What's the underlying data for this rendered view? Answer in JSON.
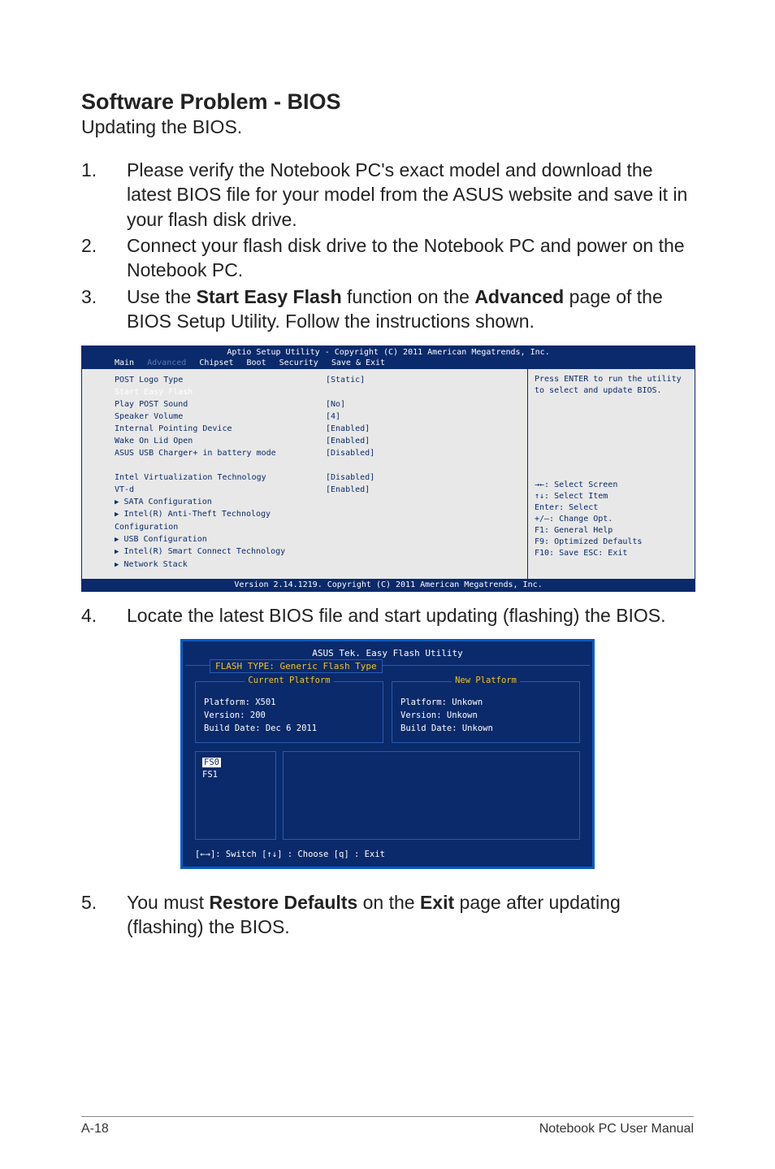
{
  "heading": "Software Problem - BIOS",
  "subtitle": "Updating the BIOS.",
  "steps": {
    "s1": {
      "num": "1.",
      "text": "Please verify the Notebook PC's exact model and download the latest BIOS file for your model from the ASUS website and save it in your flash disk drive."
    },
    "s2": {
      "num": "2.",
      "text": "Connect your flash disk drive to the Notebook PC and power on the Notebook PC."
    },
    "s3": {
      "num": "3.",
      "pre": "Use the ",
      "b1": "Start Easy Flash",
      "mid": " function on the ",
      "b2": "Advanced",
      "post": " page of the BIOS Setup Utility. Follow the instructions shown."
    },
    "s4": {
      "num": "4.",
      "text": "Locate the latest BIOS file and start updating (flashing) the BIOS."
    },
    "s5": {
      "num": "5.",
      "pre": "You must ",
      "b1": "Restore Defaults",
      "mid": " on the ",
      "b2": "Exit",
      "post": " page after updating (flashing) the BIOS."
    }
  },
  "bios": {
    "top": "Aptio Setup Utility - Copyright (C) 2011 American Megatrends, Inc.",
    "tabs": {
      "main": "Main",
      "advanced": "Advanced",
      "chipset": "Chipset",
      "boot": "Boot",
      "security": "Security",
      "save": "Save & Exit"
    },
    "rows": {
      "r1": {
        "label": "POST Logo Type",
        "val": "[Static]"
      },
      "r2": {
        "label": "Start Easy Flash",
        "val": ""
      },
      "r3": {
        "label": "Play POST Sound",
        "val": "[No]"
      },
      "r4": {
        "label": "Speaker Volume",
        "val": "[4]"
      },
      "r5": {
        "label": "Internal Pointing Device",
        "val": "[Enabled]"
      },
      "r6": {
        "label": "Wake On Lid Open",
        "val": "[Enabled]"
      },
      "r7": {
        "label": "ASUS USB Charger+ in battery mode",
        "val": "[Disabled]"
      },
      "r8": {
        "label": "Intel Virtualization Technology",
        "val": "[Disabled]"
      },
      "r9": {
        "label": "VT-d",
        "val": "[Enabled]"
      },
      "r10": {
        "label": "SATA Configuration"
      },
      "r11": {
        "label": "Intel(R) Anti-Theft Technology Configuration"
      },
      "r12": {
        "label": "USB Configuration"
      },
      "r13": {
        "label": "Intel(R) Smart Connect Technology"
      },
      "r14": {
        "label": "Network Stack"
      }
    },
    "help": {
      "h1": "Press ENTER to run the utility",
      "h2": "to select and update BIOS.",
      "k1": "→←: Select Screen",
      "k2": "↑↓:    Select Item",
      "k3": "Enter: Select",
      "k4": "+/—:  Change Opt.",
      "k5": "F1:    General Help",
      "k6": "F9:    Optimized Defaults",
      "k7": "F10:  Save    ESC: Exit"
    },
    "footer": "Version 2.14.1219. Copyright (C) 2011 American Megatrends, Inc."
  },
  "flash": {
    "title": "ASUS Tek. Easy Flash Utility",
    "type": "FLASH TYPE: Generic Flash Type",
    "cur": {
      "hdr": "Current Platform",
      "l1": "Platform:  X501",
      "l2": "Version:    200",
      "l3": "Build Date: Dec 6 2011"
    },
    "new": {
      "hdr": "New Platform",
      "l1": "Platform:  Unkown",
      "l2": "Version:    Unkown",
      "l3": "Build Date: Unkown"
    },
    "fs": {
      "fs0": "FS0",
      "fs1": "FS1"
    },
    "hints": "[←→]: Switch   [↑↓] : Choose   [q] : Exit"
  },
  "footer": {
    "left": "A-18",
    "right": "Notebook PC User Manual"
  }
}
